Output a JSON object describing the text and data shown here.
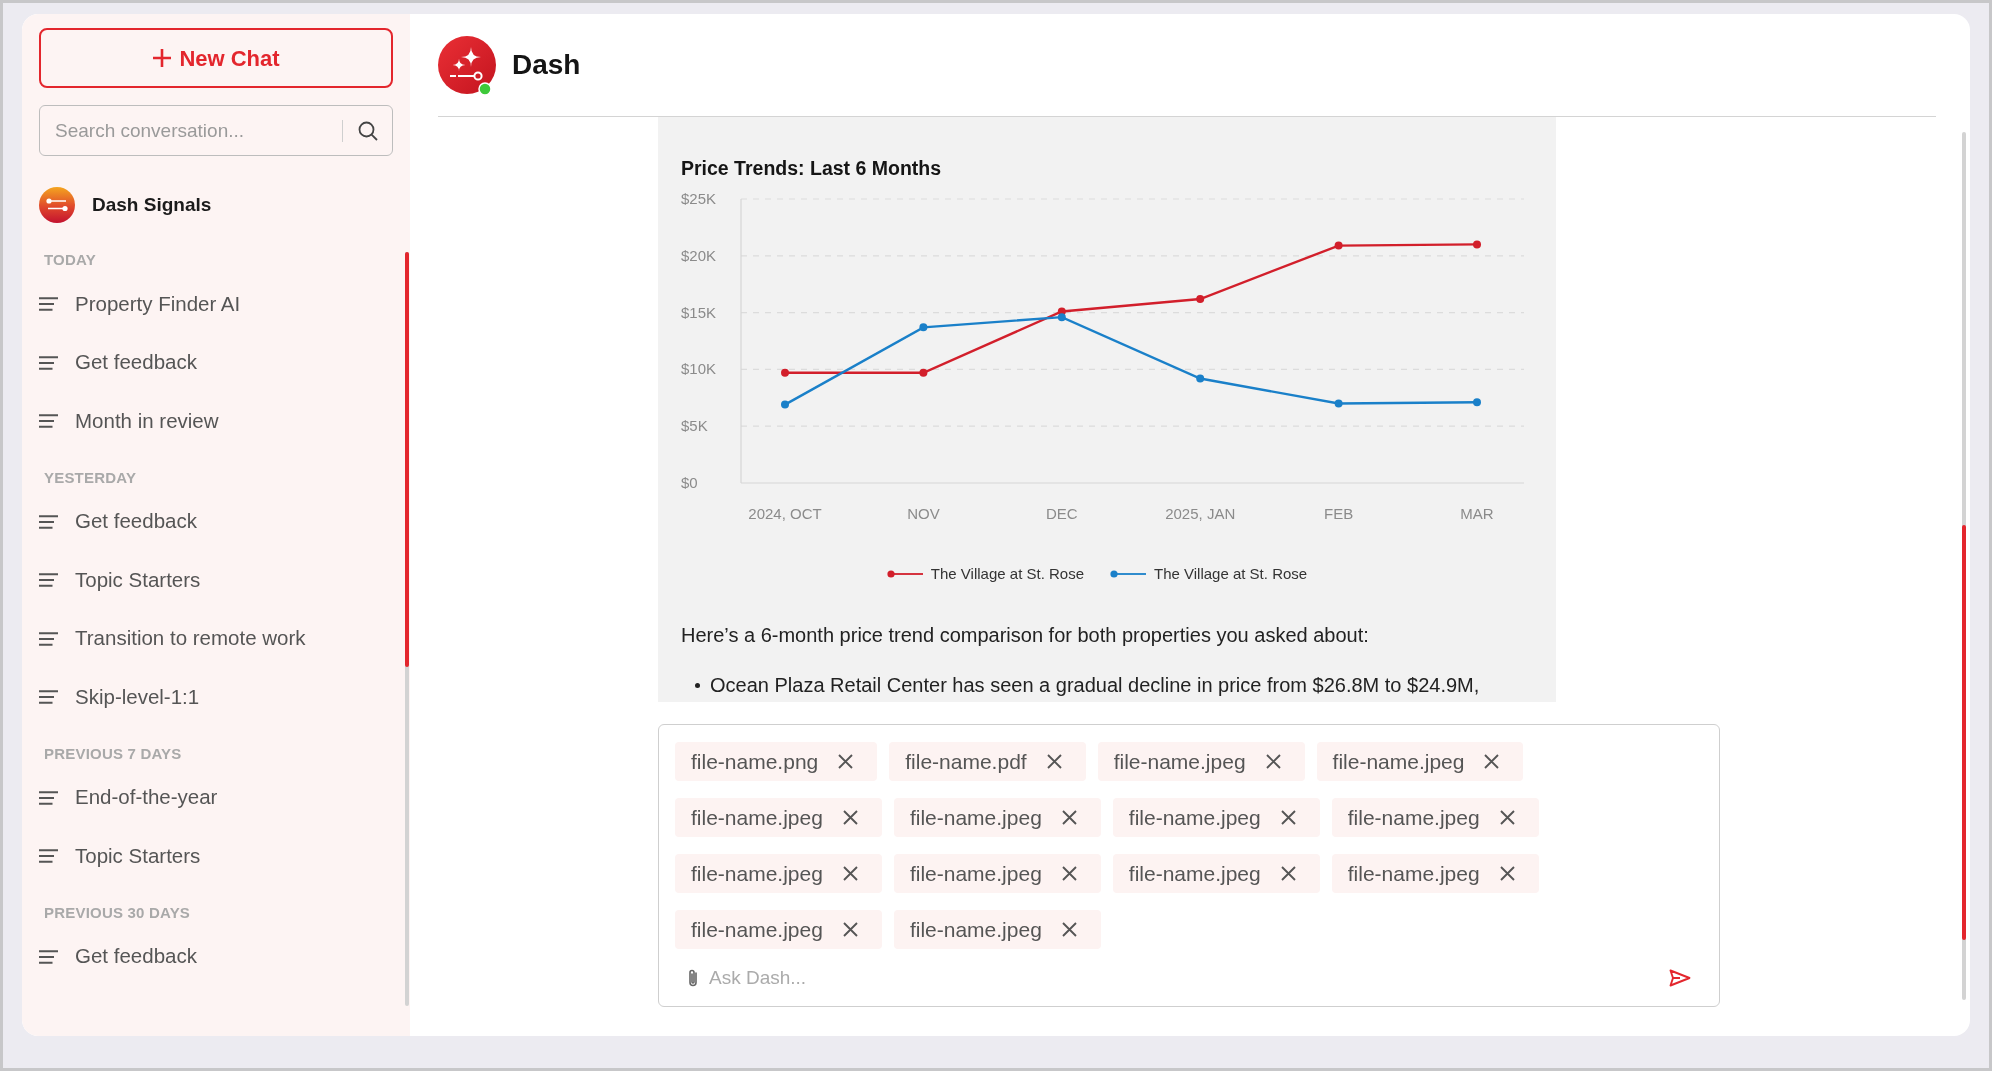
{
  "sidebar": {
    "new_chat": "New Chat",
    "search": {
      "placeholder": "Search conversation..."
    },
    "workspace": "Dash Signals",
    "sections": [
      {
        "heading": "TODAY",
        "items": [
          {
            "title": "Property Finder AI",
            "selected": false
          },
          {
            "title": "Get feedback",
            "selected": false
          },
          {
            "title": "Month in review",
            "selected": false
          }
        ]
      },
      {
        "heading": "YESTERDAY",
        "items": [
          {
            "title": "Get feedback",
            "selected": false
          },
          {
            "title": "Topic Starters",
            "selected": false
          },
          {
            "title": "Transition to remote work",
            "selected": false
          },
          {
            "title": "Skip-level-1:1",
            "selected": false
          }
        ]
      },
      {
        "heading": "PREVIOUS 7 DAYS",
        "items": [
          {
            "title": "End-of-the-year",
            "selected": false
          },
          {
            "title": "Topic Starters",
            "selected": false
          }
        ]
      },
      {
        "heading": "PREVIOUS 30 DAYS",
        "items": [
          {
            "title": "Get feedback",
            "selected": false
          }
        ]
      }
    ]
  },
  "chat": {
    "title": "Dash",
    "online": true
  },
  "message": {
    "chart_data": {
      "type": "line",
      "title": "Price Trends: Last 6 Months",
      "categories": [
        "2024, OCT",
        "NOV",
        "DEC",
        "2025, JAN",
        "FEB",
        "MAR"
      ],
      "series": [
        {
          "name": "The Village at St. Rose",
          "color": "#d21f2b",
          "marker": true,
          "values": [
            9700,
            9700,
            15100,
            16200,
            20900,
            21000
          ]
        },
        {
          "name": "The Village at St. Rose",
          "color": "#1a80c9",
          "marker": true,
          "values": [
            6900,
            13700,
            14600,
            9200,
            7000,
            7100
          ]
        }
      ],
      "ylim": [
        0,
        25000
      ],
      "yticks": [
        {
          "value": 0,
          "label": "$0"
        },
        {
          "value": 5000,
          "label": "$5K"
        },
        {
          "value": 10000,
          "label": "$10K"
        },
        {
          "value": 15000,
          "label": "$15K"
        },
        {
          "value": 20000,
          "label": "$20K"
        },
        {
          "value": 25000,
          "label": "$25K"
        }
      ],
      "grid": true
    },
    "text": "Here’s a 6-month price trend comparison for both properties you asked about:",
    "bullets": [
      "Ocean Plaza Retail Center has seen a gradual decline in price from $26.8M to $24.9M,"
    ]
  },
  "composer": {
    "attachments": [
      "file-name.png",
      "file-name.pdf",
      "file-name.jpeg",
      "file-name.jpeg",
      "file-name.jpeg",
      "file-name.jpeg",
      "file-name.jpeg",
      "file-name.jpeg",
      "file-name.jpeg",
      "file-name.jpeg",
      "file-name.jpeg",
      "file-name.jpeg",
      "file-name.jpeg",
      "file-name.jpeg"
    ],
    "placeholder": "Ask Dash..."
  }
}
